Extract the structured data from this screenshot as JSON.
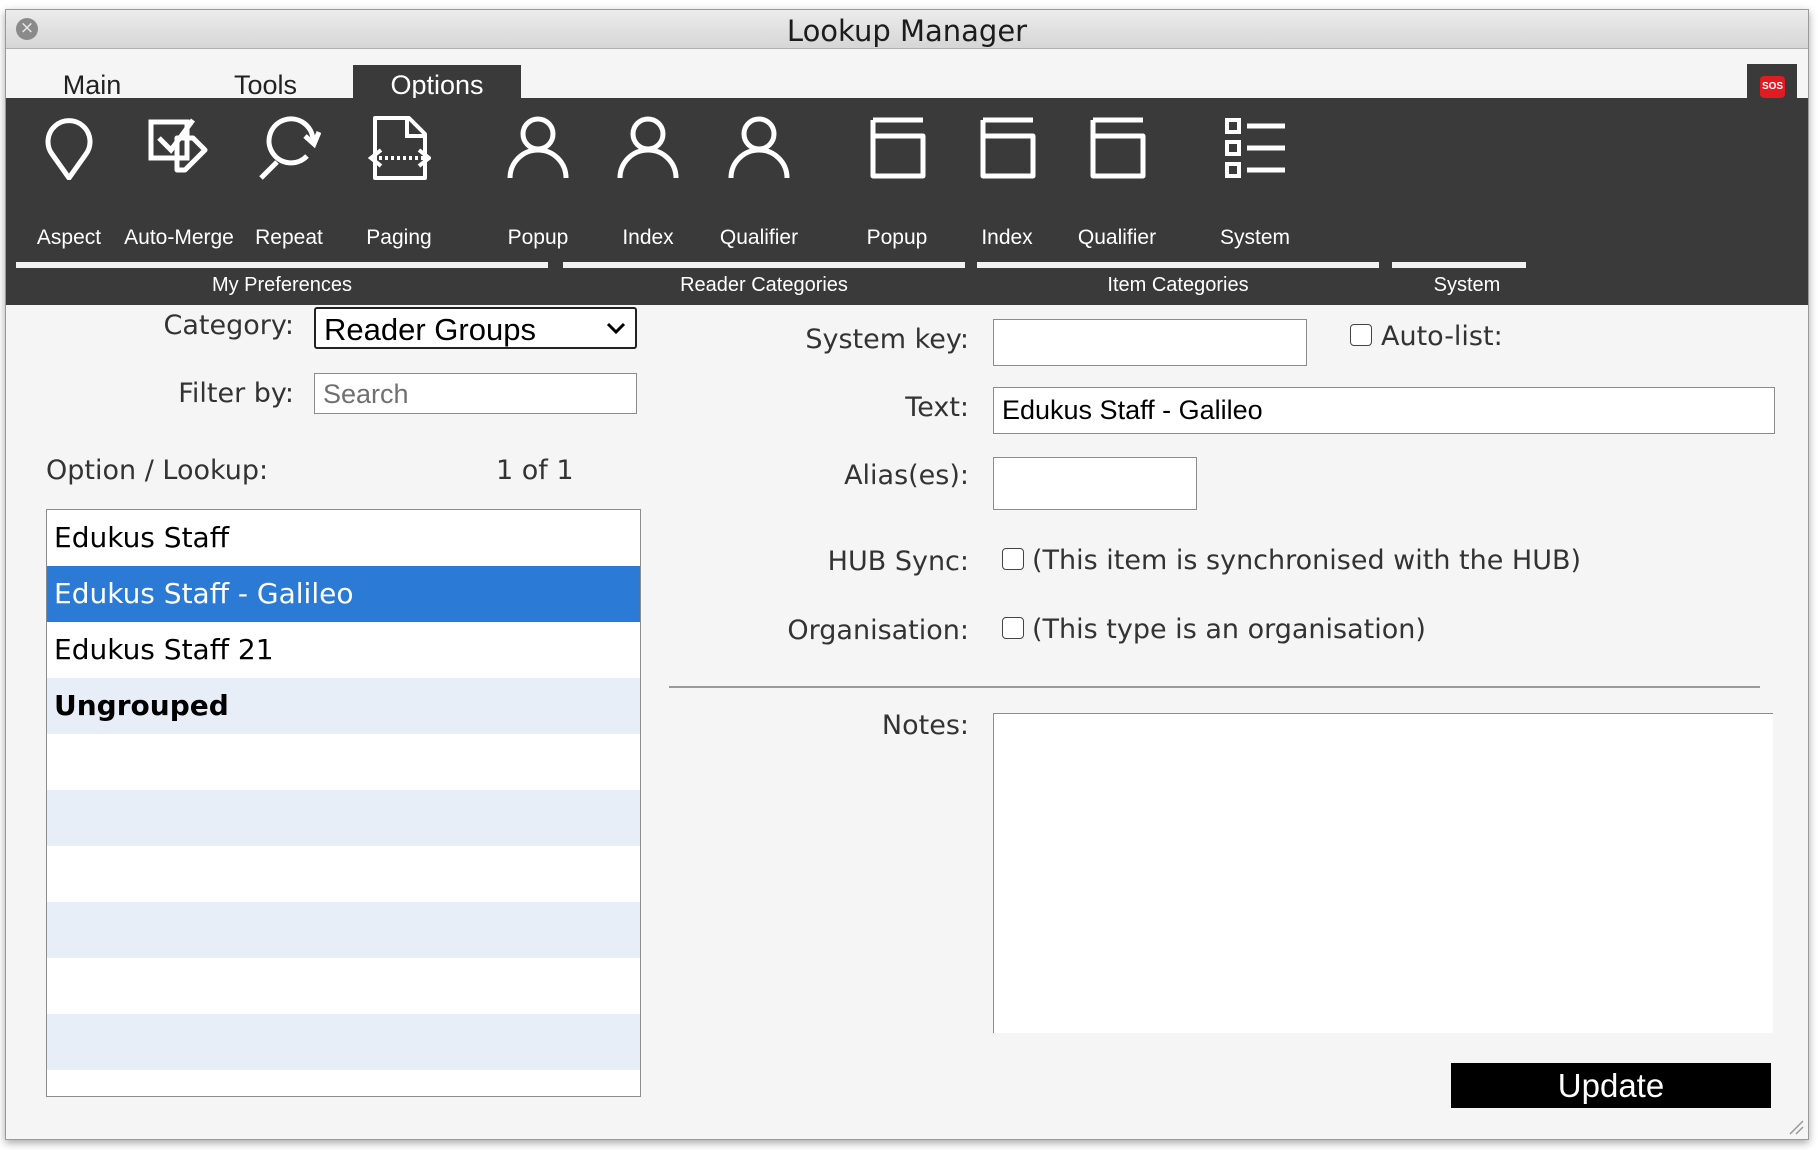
{
  "window": {
    "title": "Lookup Manager"
  },
  "tabs": [
    {
      "label": "Main"
    },
    {
      "label": "Tools"
    },
    {
      "label": "Options",
      "active": true
    }
  ],
  "sos_label": "SOS",
  "ribbon": {
    "buttons": [
      {
        "label": "Aspect",
        "icon": "map-pin-icon"
      },
      {
        "label": "Auto-Merge",
        "icon": "merge-check-icon"
      },
      {
        "label": "Repeat",
        "icon": "repeat-search-icon"
      },
      {
        "label": "Paging",
        "icon": "paging-icon"
      },
      {
        "label": "Popup",
        "icon": "person-icon"
      },
      {
        "label": "Index",
        "icon": "person-icon"
      },
      {
        "label": "Qualifier",
        "icon": "person-icon"
      },
      {
        "label": "Popup",
        "icon": "window-icon"
      },
      {
        "label": "Index",
        "icon": "window-icon"
      },
      {
        "label": "Qualifier",
        "icon": "window-icon"
      },
      {
        "label": "System",
        "icon": "list-icon"
      }
    ],
    "groups": [
      {
        "label": "My Preferences"
      },
      {
        "label": "Reader Categories"
      },
      {
        "label": "Item Categories"
      },
      {
        "label": "System"
      }
    ]
  },
  "left": {
    "category_label": "Category:",
    "category_value": "Reader Groups",
    "filter_label": "Filter by:",
    "filter_placeholder": "Search",
    "option_label": "Option / Lookup:",
    "counter": "1 of 1",
    "items": [
      {
        "text": "Edukus Staff"
      },
      {
        "text": "Edukus Staff - Galileo",
        "selected": true
      },
      {
        "text": "Edukus Staff 21"
      },
      {
        "text": "Ungrouped",
        "bold": true
      }
    ]
  },
  "right": {
    "system_key_label": "System key:",
    "system_key_value": "",
    "autolist_label": "Auto-list:",
    "text_label": "Text:",
    "text_value": "Edukus Staff - Galileo",
    "aliases_label": "Alias(es):",
    "aliases_value": "",
    "hub_label": "HUB Sync:",
    "hub_text": "(This item is synchronised with the HUB)",
    "org_label": "Organisation:",
    "org_text": "(This type is an organisation)",
    "notes_label": "Notes:",
    "notes_value": "",
    "update_label": "Update"
  },
  "colors": {
    "ribbon_bg": "#3a3a3a",
    "selection": "#2a7ad6",
    "alt_row": "#e8eef8",
    "sos_red": "#e01b22"
  }
}
